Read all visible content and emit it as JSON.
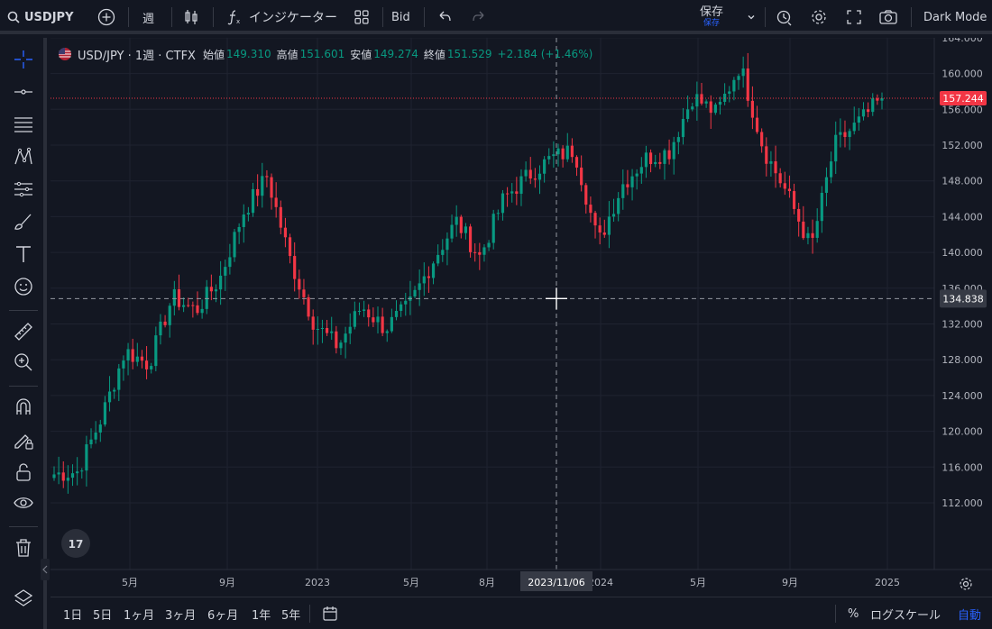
{
  "toolbar": {
    "symbol": "USDJPY",
    "interval": "週",
    "indicators": "インジケーター",
    "price_type": "Bid",
    "save_label": "保存",
    "save_sub": "保存",
    "theme": "Dark Mode"
  },
  "legend": {
    "title": "USD/JPY · 1週 · CTFX",
    "open_label": "始値",
    "open": "149.310",
    "high_label": "高値",
    "high": "151.601",
    "low_label": "安値",
    "low": "149.274",
    "close_label": "終値",
    "close": "151.529",
    "change": "+2.184 (+1.46%)"
  },
  "price_axis": {
    "ticks": [
      "164.000",
      "160.000",
      "156.000",
      "152.000",
      "148.000",
      "144.000",
      "140.000",
      "136.000",
      "132.000",
      "128.000",
      "124.000",
      "120.000",
      "116.000",
      "112.000"
    ],
    "last_price": "157.244",
    "crosshair_price": "134.838"
  },
  "time_axis": {
    "labels": [
      "5月",
      "9月",
      "2023",
      "5月",
      "8月",
      "2024",
      "5月",
      "9月",
      "2025"
    ],
    "crosshair_date": "2023/11/06"
  },
  "ranges": [
    "1日",
    "5日",
    "1ヶ月",
    "3ヶ月",
    "6ヶ月",
    "1年",
    "5年"
  ],
  "bottom_right": {
    "percent": "%",
    "log": "ログスケール",
    "auto": "自動"
  },
  "colors": {
    "up": "#089981",
    "down": "#f23645",
    "background": "#131722",
    "accent": "#2962ff"
  },
  "chart_data": {
    "type": "candlestick",
    "symbol": "USD/JPY",
    "interval": "1週",
    "ylim": [
      110,
      166
    ],
    "x_labels": [
      "5月",
      "9月",
      "2023",
      "5月",
      "8月",
      "2024",
      "5月",
      "9月",
      "2025"
    ],
    "close_path": [
      [
        "2022-01",
        115.2
      ],
      [
        "2022-03",
        115.5
      ],
      [
        "2022-03",
        121.5
      ],
      [
        "2022-04",
        129.0
      ],
      [
        "2022-05",
        127.5
      ],
      [
        "2022-06",
        135.0
      ],
      [
        "2022-07",
        133.5
      ],
      [
        "2022-08",
        137.0
      ],
      [
        "2022-09",
        144.5
      ],
      [
        "2022-10",
        148.5
      ],
      [
        "2022-11",
        139.0
      ],
      [
        "2022-12",
        132.0
      ],
      [
        "2023-01",
        129.5
      ],
      [
        "2023-02",
        134.0
      ],
      [
        "2023-03",
        131.5
      ],
      [
        "2023-04",
        134.0
      ],
      [
        "2023-05",
        139.0
      ],
      [
        "2023-06",
        143.5
      ],
      [
        "2023-07",
        139.5
      ],
      [
        "2023-08",
        146.0
      ],
      [
        "2023-09",
        148.5
      ],
      [
        "2023-10",
        150.5
      ],
      [
        "2023-11",
        151.5
      ],
      [
        "2023-12",
        141.0
      ],
      [
        "2024-01",
        147.5
      ],
      [
        "2024-02",
        150.5
      ],
      [
        "2024-03",
        151.3
      ],
      [
        "2024-04",
        157.5
      ],
      [
        "2024-05",
        155.5
      ],
      [
        "2024-06",
        161.0
      ],
      [
        "2024-07",
        151.5
      ],
      [
        "2024-08",
        146.5
      ],
      [
        "2024-09",
        140.5
      ],
      [
        "2024-10",
        152.0
      ],
      [
        "2024-11",
        154.5
      ],
      [
        "2024-12",
        157.2
      ]
    ],
    "last": 157.244,
    "crosshair": {
      "price": 134.838,
      "date": "2023/11/06"
    }
  }
}
